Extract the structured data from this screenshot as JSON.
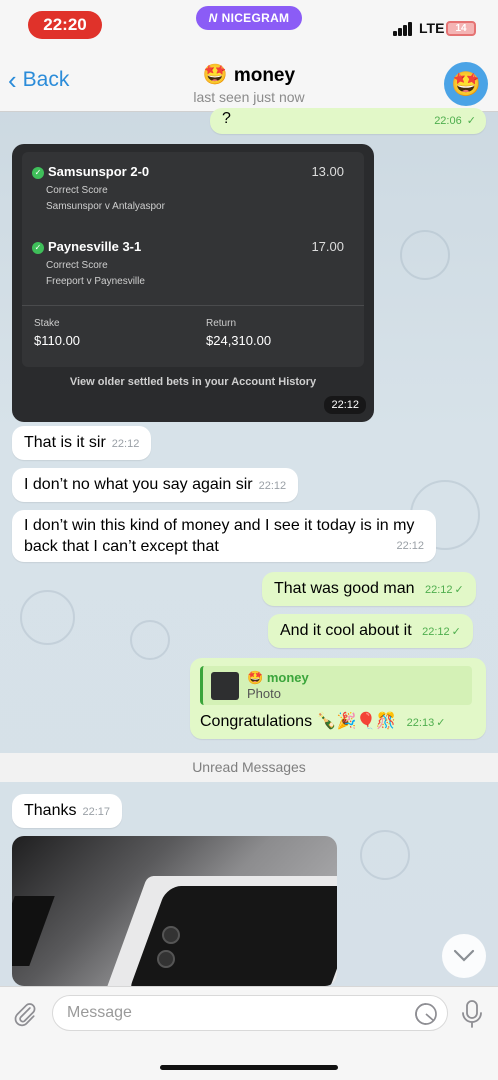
{
  "status_bar": {
    "time": "22:20",
    "carrier_app": "NICEGRAM",
    "network": "LTE",
    "battery": "14"
  },
  "header": {
    "back_label": "Back",
    "title_emoji": "🤩",
    "title": "money",
    "subtitle": "last seen just now",
    "avatar_emoji": "🤩"
  },
  "messages": {
    "m0": {
      "text": "?",
      "time": "22:06",
      "status": "✓"
    },
    "bet_photo": {
      "bet1_name": "Samsunspor 2-0",
      "bet1_odds": "13.00",
      "bet1_market": "Correct Score",
      "bet1_match": "Samsunspor v Antalyaspor",
      "bet2_name": "Paynesville 3-1",
      "bet2_odds": "17.00",
      "bet2_market": "Correct Score",
      "bet2_match": "Freeport v Paynesville",
      "stake_label": "Stake",
      "stake_value": "$110.00",
      "return_label": "Return",
      "return_value": "$24,310.00",
      "history_text": "View older settled bets in your Account History",
      "time": "22:12"
    },
    "m1": {
      "text": "That is it sir",
      "time": "22:12"
    },
    "m2": {
      "text": "I don’t no what you say again sir",
      "time": "22:12"
    },
    "m3": {
      "text": "I don’t win this kind of money and I see it today is in my back that I can’t except that",
      "time": "22:12"
    },
    "m4": {
      "text": "That was good man",
      "time": "22:12",
      "status": "✓"
    },
    "m5": {
      "text": "And it cool about it",
      "time": "22:12",
      "status": "✓"
    },
    "m6": {
      "reply_emoji": "🤩",
      "reply_name": "money",
      "reply_type": "Photo",
      "text": "Congratulations 🍾🎉🎈🎊",
      "time": "22:13",
      "status": "✓"
    },
    "unread_label": "Unread Messages",
    "m7": {
      "text": "Thanks",
      "time": "22:17"
    }
  },
  "input": {
    "placeholder": "Message"
  },
  "colors": {
    "accent": "#2b8cd9",
    "outgoing_bubble": "#e2f8c8",
    "time_pill": "#e0322a",
    "nicegram_pill": "#8b5cf6"
  }
}
